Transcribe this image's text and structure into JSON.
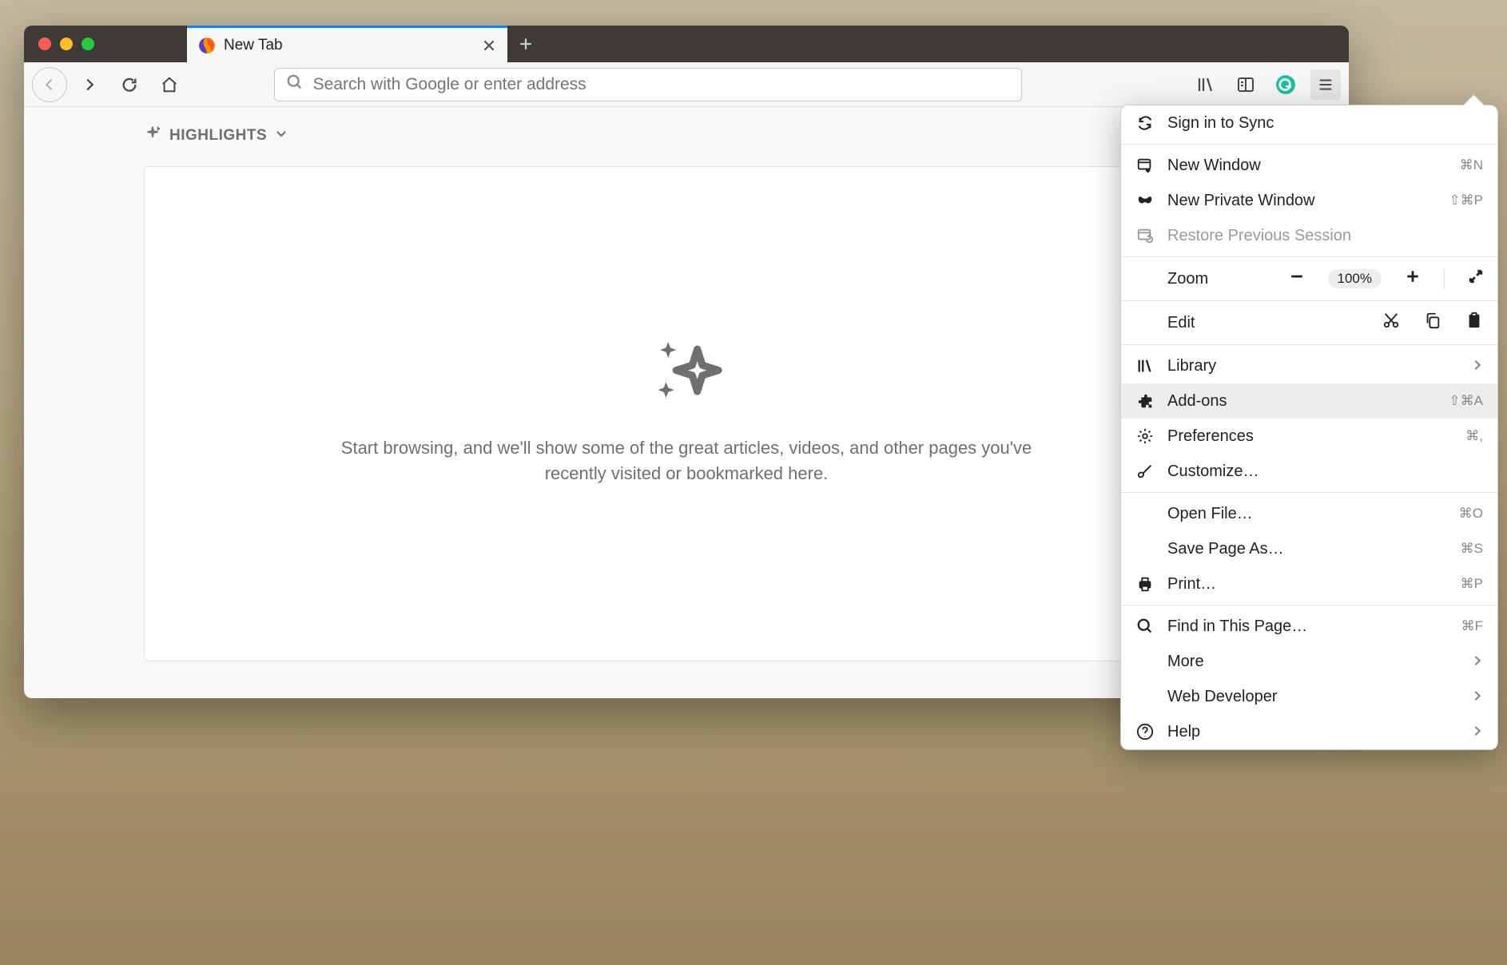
{
  "tab": {
    "title": "New Tab"
  },
  "urlbar": {
    "placeholder": "Search with Google or enter address"
  },
  "highlights": {
    "header": "HIGHLIGHTS",
    "message": "Start browsing, and we'll show some of the great articles, videos, and other pages you've recently visited or bookmarked here."
  },
  "menu": {
    "sign_in": "Sign in to Sync",
    "new_window": "New Window",
    "new_window_sc": "⌘N",
    "new_private": "New Private Window",
    "new_private_sc": "⇧⌘P",
    "restore": "Restore Previous Session",
    "zoom_label": "Zoom",
    "zoom_value": "100%",
    "edit_label": "Edit",
    "library": "Library",
    "addons": "Add-ons",
    "addons_sc": "⇧⌘A",
    "preferences": "Preferences",
    "preferences_sc": "⌘,",
    "customize": "Customize…",
    "open_file": "Open File…",
    "open_file_sc": "⌘O",
    "save_page": "Save Page As…",
    "save_page_sc": "⌘S",
    "print": "Print…",
    "print_sc": "⌘P",
    "find": "Find in This Page…",
    "find_sc": "⌘F",
    "more": "More",
    "web_dev": "Web Developer",
    "help": "Help"
  }
}
